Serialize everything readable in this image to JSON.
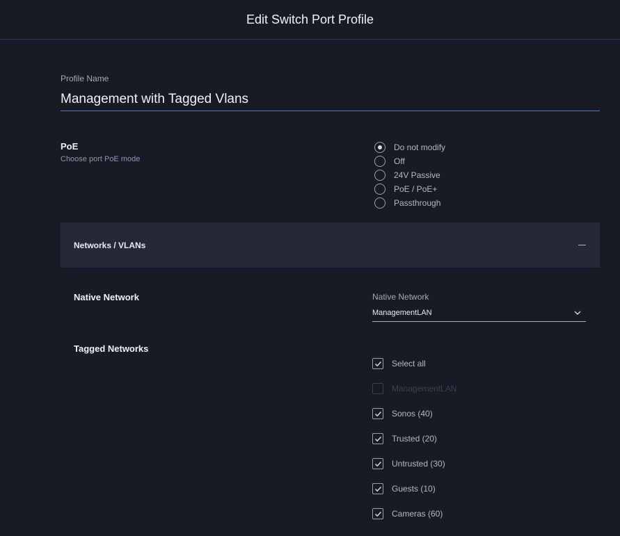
{
  "header": {
    "title": "Edit Switch Port Profile"
  },
  "profile": {
    "label": "Profile Name",
    "value": "Management with Tagged Vlans"
  },
  "poe": {
    "title": "PoE",
    "subtitle": "Choose port PoE mode",
    "options": [
      {
        "label": "Do not modify",
        "checked": true
      },
      {
        "label": "Off",
        "checked": false
      },
      {
        "label": "24V Passive",
        "checked": false
      },
      {
        "label": "PoE / PoE+",
        "checked": false
      },
      {
        "label": "Passthrough",
        "checked": false
      }
    ]
  },
  "networks_section": {
    "title": "Networks / VLANs"
  },
  "native": {
    "title": "Native Network",
    "field_label": "Native Network",
    "selected": "ManagementLAN"
  },
  "tagged": {
    "title": "Tagged Networks",
    "items": [
      {
        "label": "Select all",
        "checked": true,
        "disabled": false
      },
      {
        "label": "ManagementLAN",
        "checked": false,
        "disabled": true
      },
      {
        "label": "Sonos (40)",
        "checked": true,
        "disabled": false
      },
      {
        "label": "Trusted (20)",
        "checked": true,
        "disabled": false
      },
      {
        "label": "Untrusted (30)",
        "checked": true,
        "disabled": false
      },
      {
        "label": "Guests (10)",
        "checked": true,
        "disabled": false
      },
      {
        "label": "Cameras (60)",
        "checked": true,
        "disabled": false
      }
    ]
  }
}
